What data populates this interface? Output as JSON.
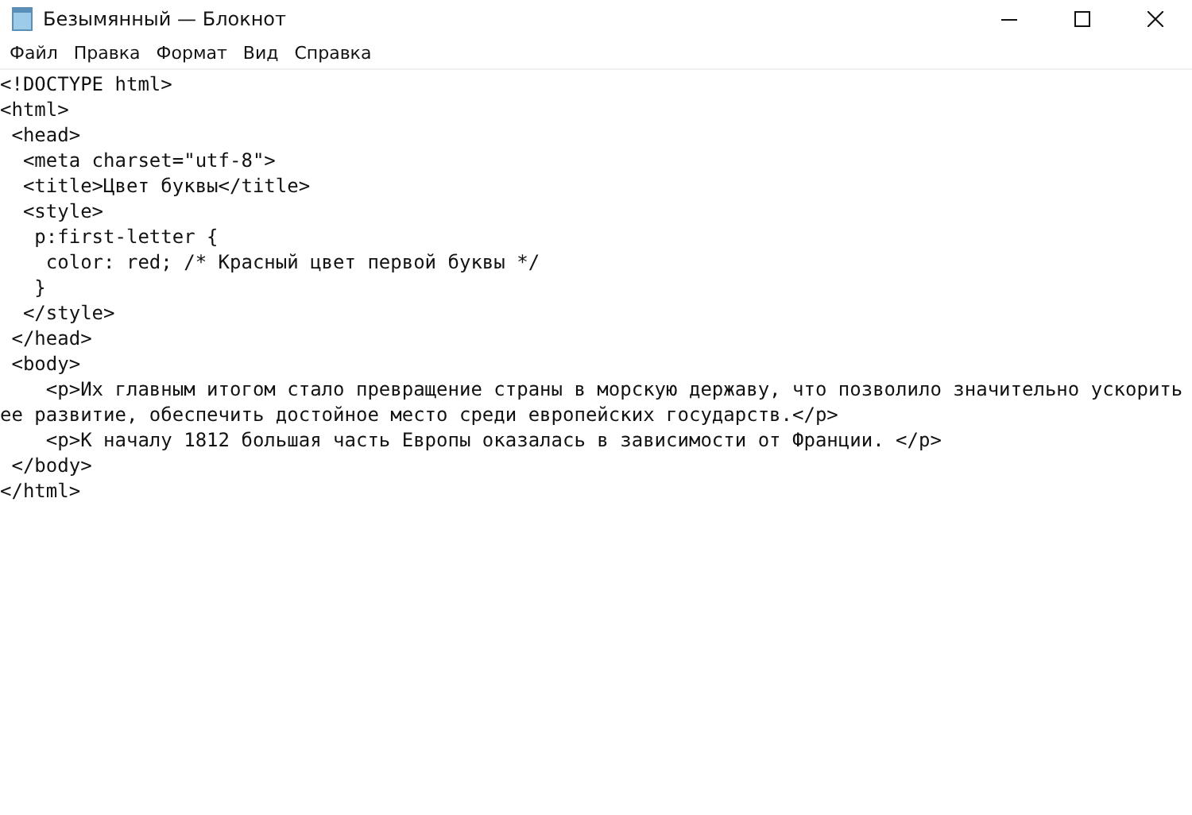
{
  "window": {
    "title": "Безымянный — Блокнот"
  },
  "menu": [
    "Файл",
    "Правка",
    "Формат",
    "Вид",
    "Справка"
  ],
  "lines": [
    "<!DOCTYPE html>",
    "<html>",
    " <head>",
    "  <meta charset=\"utf-8\">",
    "  <title>Цвет буквы</title>",
    "  <style>",
    "   p:first-letter {",
    "    color: red; /* Красный цвет первой буквы */",
    "   }",
    "  </style>",
    " </head>",
    " <body>",
    "    <p>Их главным итогом стало превращение страны в морскую державу, что позволило значительно ускорить",
    "ее развитие, обеспечить достойное место среди европейских государств.</p>",
    "    <p>К началу 1812 большая часть Европы оказалась в зависимости от Франции. </p>",
    " </body>",
    "</html>"
  ]
}
